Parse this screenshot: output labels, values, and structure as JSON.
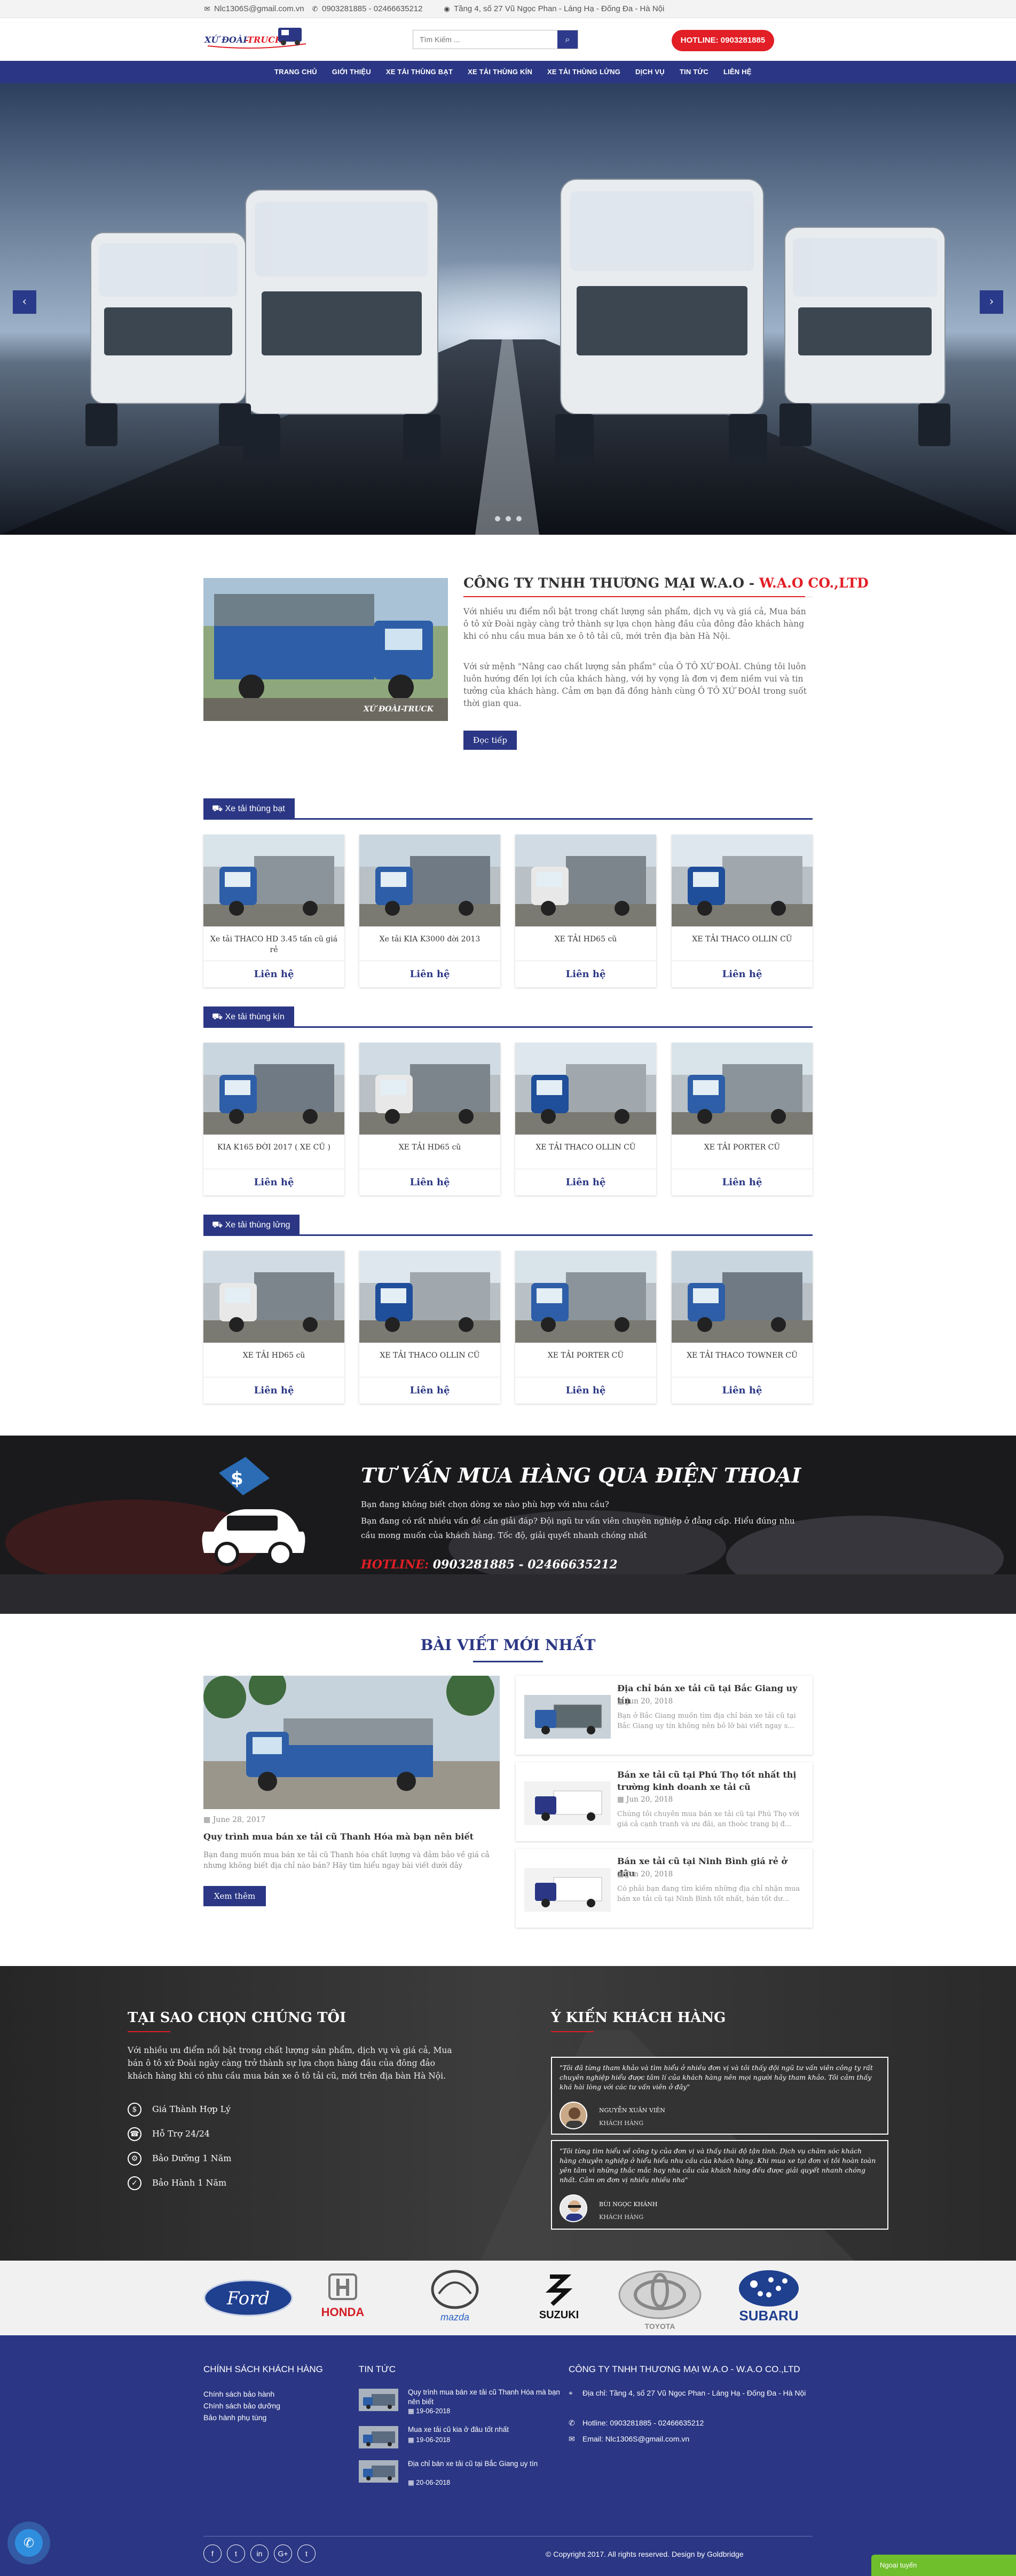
{
  "topbar": {
    "email": "Nlc1306S@gmail.com.vn",
    "phone": "0903281885 - 02466635212",
    "address": "Tầng 4, số 27 Vũ Ngọc Phan - Láng Hạ - Đống Đa - Hà Nội"
  },
  "header": {
    "logo_text": "XE ĐOÀI-TRUCK",
    "search_placeholder": "Tìm Kiếm ...",
    "hotline": "HOTLINE: 0903281885"
  },
  "nav": [
    "TRANG CHỦ",
    "GIỚI THIỆU",
    "XE TẢI THÙNG BẠT",
    "XE TẢI THÙNG KÍN",
    "XE TẢI THÙNG LỬNG",
    "DỊCH VỤ",
    "TIN TỨC",
    "LIÊN HỆ"
  ],
  "about": {
    "title_main": "CÔNG TY TNHH THƯƠNG MẠI W.A.O - ",
    "title_red": "W.A.O CO.,LTD",
    "p1": "Với nhiều ưu điểm nổi bật trong chất lượng sản phẩm, dịch vụ và giá cả, Mua bán ô tô xứ Đoài ngày càng trở thành sự lựa chọn hàng đầu của đông đảo khách hàng khi có nhu cầu mua bán xe ô tô tải cũ, mới trên địa bàn Hà Nội.",
    "p2": "Với sứ mệnh \"Nâng cao chất lượng sản phẩm\" của Ô TÔ XỨ ĐOÀI. Chúng tôi luôn luôn hướng đến lợi ích của khách hàng, với hy vọng là đơn vị đem niềm vui và tin tưởng của khách hàng. Cảm ơn bạn đã đồng hành cùng Ô TÔ XỨ ĐOÀI trong suốt thời gian qua.",
    "button": "Đọc tiếp"
  },
  "sections": [
    {
      "title": "Xe tải thùng bạt",
      "cta": "Liên hệ",
      "items": [
        "Xe tải THACO HD 3.45 tấn cũ giá rẻ",
        "Xe tải KIA K3000 đời 2013",
        "XE TẢI HD65 cũ",
        "XE TẢI THACO OLLIN CŨ"
      ]
    },
    {
      "title": "Xe tải thùng kín",
      "cta": "Liên hệ",
      "items": [
        "KIA K165 ĐỜI 2017 ( XE CŨ )",
        "XE TẢI HD65 cũ",
        "XE TẢI THACO OLLIN CŨ",
        "XE TẢI PORTER CŨ"
      ]
    },
    {
      "title": "Xe tải thùng lửng",
      "cta": "Liên hệ",
      "items": [
        "XE TẢI HD65 cũ",
        "XE TẢI THACO OLLIN CŨ",
        "XE TẢI PORTER CŨ",
        "XE TẢI THACO TOWNER CŨ"
      ]
    }
  ],
  "consult": {
    "title": "TƯ VẤN MUA HÀNG QUA ĐIỆN THOẠI",
    "line1": "Bạn đang không biết chọn dòng xe nào phù hợp với nhu cầu?",
    "line2": "Bạn đang có rất nhiều vấn đề cần giải đáp? Đội ngũ tư vấn viên chuyên nghiệp ở đẳng cấp. Hiểu đúng nhu cầu mong muốn của khách hàng. Tốc độ, giải quyết nhanh chóng nhất",
    "hot_label": "HOTLINE:",
    "hot_value": " 0903281885 - 02466635212"
  },
  "news": {
    "title": "BÀI VIẾT MỚI NHẤT",
    "main": {
      "date": "June 28, 2017",
      "title": "Quy trình mua bán xe tải cũ Thanh Hóa mà bạn nên biết",
      "excerpt": "Bạn đang muốn mua bán xe tải cũ Thanh hóa chất lượng và đảm bảo về giá cả nhưng không biết địa chỉ nào bán? Hãy tìm hiểu ngay bài viết dưới đây",
      "button": "Xem thêm"
    },
    "side": [
      {
        "title": "Địa chỉ bán xe tải cũ tại Bắc Giang uy tín",
        "date": "Jun 20, 2018",
        "excerpt1": "Bạn ở Bắc Giang muốn tìm địa chỉ bán xe tải cũ tại",
        "excerpt2": "Bắc Giang uy tín không nên bỏ lỡ bài viết ngay s..."
      },
      {
        "title": "Bán xe tải cũ tại Phú Thọ tốt nhất thị trường kinh doanh xe tải cũ",
        "date": "Jun 20, 2018",
        "excerpt1": "Chúng tôi chuyên mua bán xe tải cũ tại Phú Thọ với",
        "excerpt2": "giá cả cạnh tranh và ưu đãi, an thoòc trang bị đ..."
      },
      {
        "title": "Bán xe tải cũ tại Ninh Bình giá rẻ ở đâu",
        "date": "Jun 20, 2018",
        "excerpt1": "Có phải bạn đang tìm kiếm những địa chỉ nhận mua",
        "excerpt2": "bán xe tải cũ tại Ninh Bình tốt nhất, bán tốt dư..."
      }
    ]
  },
  "why": {
    "title": "TẠI SAO CHỌN CHÚNG TÔI",
    "text": "Với nhiều ưu điểm nổi bật trong chất lượng sản phẩm, dịch vụ và giá cả, Mua bán ô tô xứ Đoài ngày càng trở thành sự lựa chọn hàng đầu của đông đảo khách hàng khi có nhu cầu mua bán xe ô tô tải cũ, mới trên địa bàn Hà Nội.",
    "features": [
      "Giá Thành Hợp Lý",
      "Hỗ Trợ 24/24",
      "Bảo Dưỡng 1 Năm",
      "Bảo Hành 1 Năm"
    ]
  },
  "testimonials": {
    "title": "Ý KIẾN KHÁCH HÀNG",
    "items": [
      {
        "quote": "\"Tôi đã từng tham khảo và tìm hiểu ở nhiều đơn vị và tôi thấy đội ngũ tư vấn viên công ty rất chuyên nghiệp hiểu được tâm lí của khách hàng nên mọi người hãy tham khảo. Tôi cảm thấy khá hài lòng với các tư vấn viên ở đây\"",
        "name": "NGUYỄN XUÂN VIÊN",
        "role": "KHÁCH HÀNG"
      },
      {
        "quote": "\"Tôi từng tìm hiểu về công ty của đơn vị và thấy thái độ tận tình. Dịch vụ chăm sóc khách hàng chuyên nghiệp ở hiểu hiểu nhu cầu của khách hàng. Khi mua xe tại đơn vị tôi hoàn toàn yên tâm vì những thắc mắc hay nhu cầu của khách hàng đều được giải quyết nhanh chóng nhất. Cảm ơn đơn vị nhiều nhiều nha\"",
        "name": "BÙI NGỌC KHÁNH",
        "role": "KHÁCH HÀNG"
      }
    ]
  },
  "brands": [
    "Ford",
    "HONDA",
    "mazda",
    "SUZUKI",
    "TOYOTA",
    "SUBARU"
  ],
  "footer": {
    "policy_title": "CHÍNH SÁCH KHÁCH HÀNG",
    "policy_items": [
      "Chính sách bảo hành",
      "Chính sách bảo dưỡng",
      "Bảo hành phụ tùng"
    ],
    "news_title": "TIN TỨC",
    "news_items": [
      {
        "title": "Quy trình mua bán xe tải cũ Thanh Hóa mà bạn nên biết",
        "date": "19-06-2018"
      },
      {
        "title": "Mua xe tải cũ kia ở đâu tốt nhất",
        "date": "19-06-2018"
      },
      {
        "title": "Địa chỉ bán xe tải cũ tại Bắc Giang uy tín",
        "date": "20-06-2018"
      }
    ],
    "company_title": "CÔNG TY TNHH THƯƠNG MẠI W.A.O - W.A.O CO.,LTD",
    "address": "Địa chỉ: Tầng 4, số 27 Vũ Ngọc Phan - Láng Hạ - Đống Đa - Hà Nội",
    "hotline": "Hotline: 0903281885 - 02466635212",
    "email": "Email: Nlc1306S@gmail.com.vn",
    "social": [
      "f",
      "t",
      "in",
      "G+",
      "t"
    ],
    "copyright": "© Copyright 2017. All rights reserved. Design by Goldbridge",
    "online": "Ngoại tuyến"
  },
  "colors": {
    "primary": "#2b3784",
    "accent": "#e21e26",
    "online": "#6fbe2b"
  }
}
